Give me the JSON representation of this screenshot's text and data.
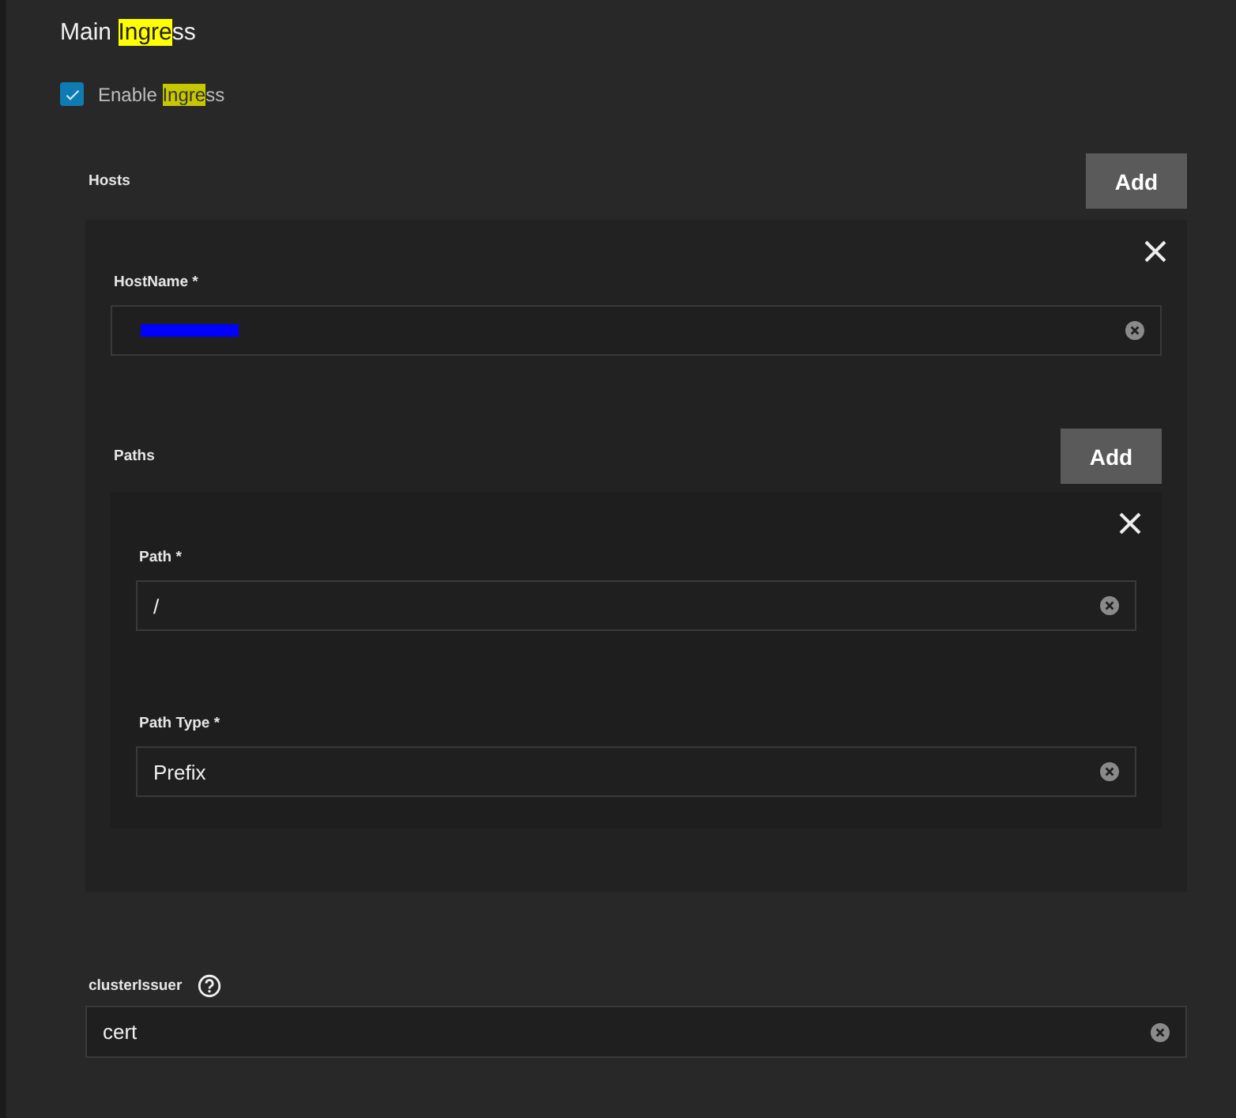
{
  "title": [
    {
      "text": "Main ",
      "highlight": false
    },
    {
      "text": "Ingre",
      "highlight": true
    },
    {
      "text": "ss",
      "highlight": false
    }
  ],
  "enable": {
    "checked": true,
    "label": [
      {
        "text": "Enable ",
        "highlight": false
      },
      {
        "text": "Ingre",
        "highlight": true
      },
      {
        "text": "ss",
        "highlight": false
      }
    ]
  },
  "hosts": {
    "label": "Hosts",
    "add": "Add",
    "items": [
      {
        "hostname": {
          "label": "HostName *",
          "value_redacted": true
        },
        "paths": {
          "label": "Paths",
          "add": "Add",
          "items": [
            {
              "fields": [
                {
                  "label": "Path *",
                  "value": "/"
                },
                {
                  "label": "Path Type *",
                  "value": "Prefix"
                }
              ]
            }
          ]
        }
      }
    ]
  },
  "cluster_issuer": {
    "label": "clusterIssuer",
    "value": "cert"
  }
}
